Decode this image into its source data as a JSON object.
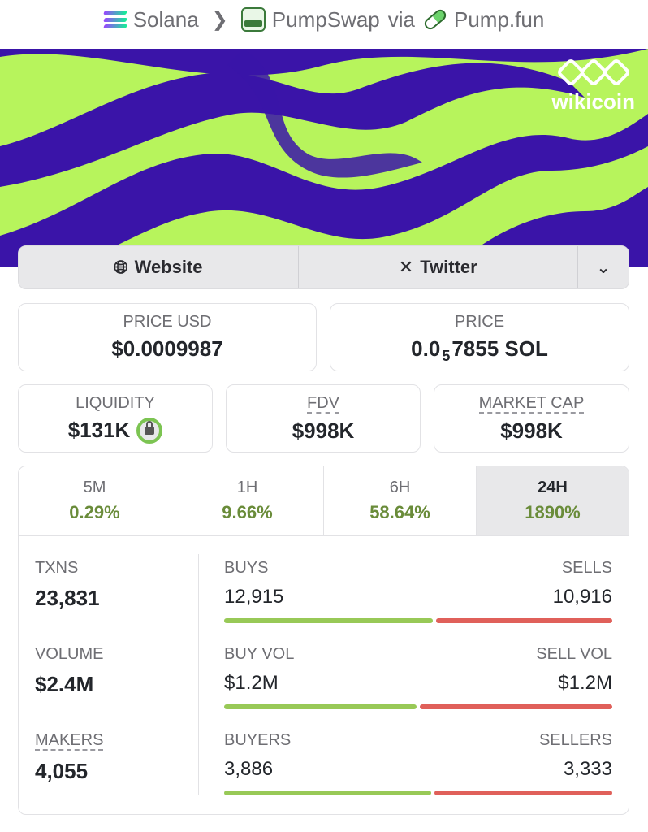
{
  "breadcrumb": {
    "chain": "Solana",
    "dex": "PumpSwap",
    "via": "via",
    "launchpad": "Pump.fun"
  },
  "banner": {
    "logo_text": "wikicoin",
    "colors": {
      "green": "#b7f45c",
      "purple": "#3a14a8"
    }
  },
  "links": {
    "website": "Website",
    "twitter": "Twitter"
  },
  "price": {
    "usd_label": "PRICE USD",
    "usd_value": "$0.0009987",
    "native_label": "PRICE",
    "native_prefix": "0.0",
    "native_zeros": "5",
    "native_suffix": "7855 SOL"
  },
  "metrics": {
    "liquidity_label": "LIQUIDITY",
    "liquidity_value": "$131K",
    "fdv_label": "FDV",
    "fdv_value": "$998K",
    "mcap_label": "MARKET CAP",
    "mcap_value": "$998K"
  },
  "periods": [
    {
      "label": "5M",
      "change": "0.29%"
    },
    {
      "label": "1H",
      "change": "9.66%"
    },
    {
      "label": "6H",
      "change": "58.64%"
    },
    {
      "label": "24H",
      "change": "1890%"
    }
  ],
  "stats": {
    "txns_label": "TXNS",
    "txns_value": "23,831",
    "volume_label": "VOLUME",
    "volume_value": "$2.4M",
    "makers_label": "MAKERS",
    "makers_value": "4,055",
    "buys_label": "BUYS",
    "buys_value": "12,915",
    "sells_label": "SELLS",
    "sells_value": "10,916",
    "buy_share": 0.542,
    "buyvol_label": "BUY VOL",
    "buyvol_value": "$1.2M",
    "sellvol_label": "SELL VOL",
    "sellvol_value": "$1.2M",
    "buyvol_share": 0.5,
    "buyers_label": "BUYERS",
    "buyers_value": "3,886",
    "sellers_label": "SELLERS",
    "sellers_value": "3,333",
    "buyers_share": 0.538
  },
  "status_colors": {
    "positive": "#6a8c3a",
    "buy": "#98c957",
    "sell": "#e0605a"
  }
}
